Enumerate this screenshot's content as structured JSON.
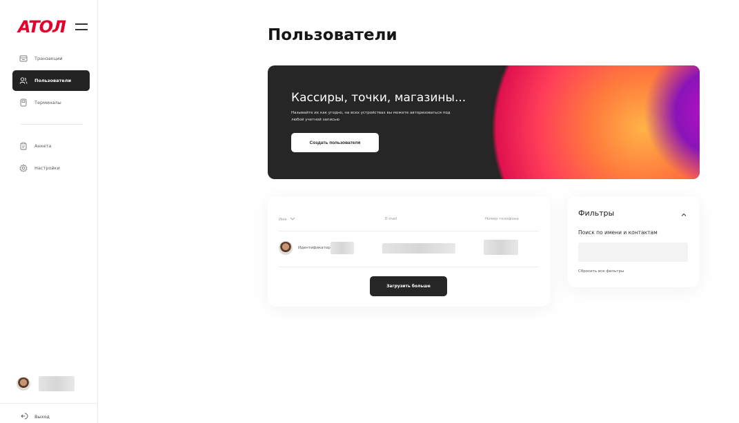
{
  "brand": {
    "logo_text": "ATOL",
    "accent_color": "#e5002b"
  },
  "sidebar": {
    "menu_icon": "burger-icon",
    "items_top": [
      {
        "label": "Транзакции",
        "icon": "receipt-icon",
        "active": false
      },
      {
        "label": "Пользователи",
        "icon": "users-icon",
        "active": true
      },
      {
        "label": "Терминалы",
        "icon": "terminal-icon",
        "active": false
      }
    ],
    "items_bottom": [
      {
        "label": "Анкета",
        "icon": "clipboard-icon"
      },
      {
        "label": "Настройки",
        "icon": "gear-icon"
      }
    ],
    "user": {
      "avatar": "avatar-image",
      "name": ""
    },
    "logout_label": "Выход"
  },
  "page": {
    "title": "Пользователи"
  },
  "hero": {
    "title": "Кассиры, точки, магазины...",
    "subtitle": "Называйте их как угодно, на всех устройствах вы можете авторизоваться под любой учетной записью",
    "button_label": "Создать пользователя"
  },
  "table": {
    "columns": {
      "name": "Имя",
      "email": "E-mail",
      "phone": "Номер телефона"
    },
    "rows": [
      {
        "label": "Идентификатор:",
        "id": "",
        "email": "",
        "phone": ""
      }
    ],
    "load_more_label": "Загрузить больше"
  },
  "filters": {
    "title": "Фильтры",
    "search_label": "Поиск по имени и контактам",
    "search_value": "",
    "reset_label": "Сбросить все фильтры"
  }
}
